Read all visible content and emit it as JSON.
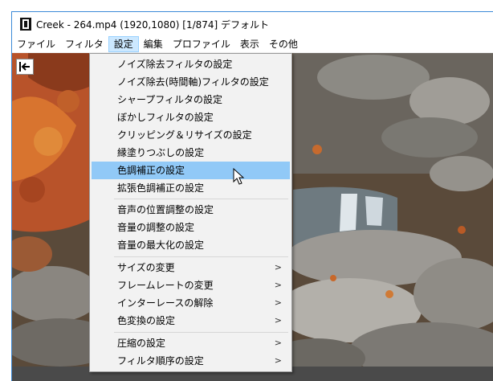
{
  "window": {
    "title": "Creek - 264.mp4 (1920,1080)  [1/874]  デフォルト"
  },
  "menubar": [
    "ファイル",
    "フィルタ",
    "設定",
    "編集",
    "プロファイル",
    "表示",
    "その他"
  ],
  "menu": {
    "items": [
      {
        "label": "ノイズ除去フィルタの設定"
      },
      {
        "label": "ノイズ除去(時間軸)フィルタの設定"
      },
      {
        "label": "シャープフィルタの設定"
      },
      {
        "label": "ぼかしフィルタの設定"
      },
      {
        "label": "クリッピング＆リサイズの設定"
      },
      {
        "label": "縁塗りつぶしの設定"
      },
      {
        "label": "色調補正の設定"
      },
      {
        "label": "拡張色調補正の設定"
      },
      {
        "label": "音声の位置調整の設定"
      },
      {
        "label": "音量の調整の設定"
      },
      {
        "label": "音量の最大化の設定"
      },
      {
        "label": "サイズの変更",
        "submenu_icon": "chevron-right-icon",
        "arrow": ">"
      },
      {
        "label": "フレームレートの変更",
        "submenu_icon": "chevron-right-icon",
        "arrow": ">"
      },
      {
        "label": "インターレースの解除",
        "submenu_icon": "chevron-right-icon",
        "arrow": ">"
      },
      {
        "label": "色変換の設定",
        "submenu_icon": "chevron-right-icon",
        "arrow": ">"
      },
      {
        "label": "圧縮の設定",
        "submenu_icon": "chevron-right-icon",
        "arrow": ">"
      },
      {
        "label": "フィルタ順序の設定",
        "submenu_icon": "chevron-right-icon",
        "arrow": ">"
      }
    ],
    "highlighted": "色調補正の設定"
  },
  "colors": {
    "menu_highlight": "#91c9f7",
    "menubar_active": "#cce8ff",
    "status_bar": "#4a4a4a"
  }
}
